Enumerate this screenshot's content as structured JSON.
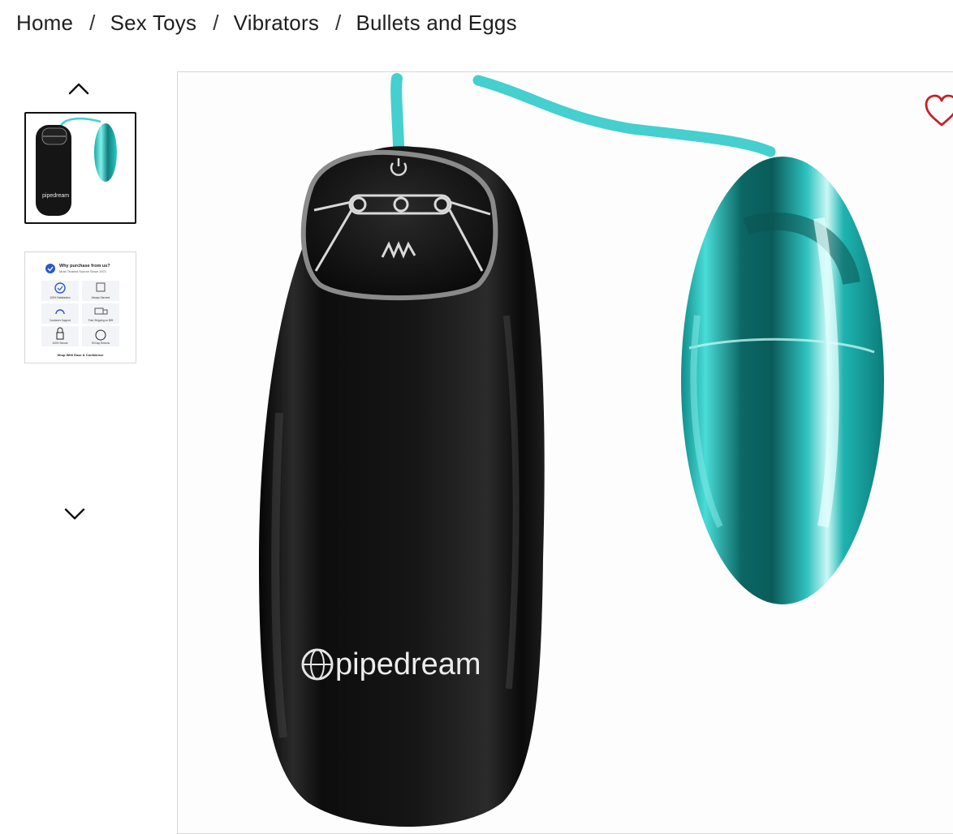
{
  "breadcrumb": {
    "items": [
      {
        "label": "Home"
      },
      {
        "label": "Sex Toys"
      },
      {
        "label": "Vibrators"
      },
      {
        "label": "Bullets and Eggs"
      }
    ],
    "separator": "/"
  },
  "gallery": {
    "up_icon": "chevron-up-icon",
    "down_icon": "chevron-down-icon",
    "thumbnails": [
      {
        "name": "product-photo-thumbnail",
        "selected": true
      },
      {
        "name": "why-purchase-thumbnail",
        "selected": false,
        "title": "Why purchase from us?",
        "subtitle": "Most Trusted Source Since 1971",
        "badges": [
          "100% Satisfaction",
          "Always Discreet",
          "Customer Support",
          "Free Shipping on $99",
          "100% Secure",
          "90 Day Returns"
        ],
        "footer": "Shop With Ease & Confidence"
      }
    ]
  },
  "product": {
    "brand_logo_text": "pipedream",
    "colors": {
      "bullet": "#2ec9c6",
      "remote": "#121212",
      "cord": "#45cfcf",
      "wishlist": "#c8202a"
    }
  },
  "wishlist": {
    "icon": "heart-outline-icon"
  }
}
